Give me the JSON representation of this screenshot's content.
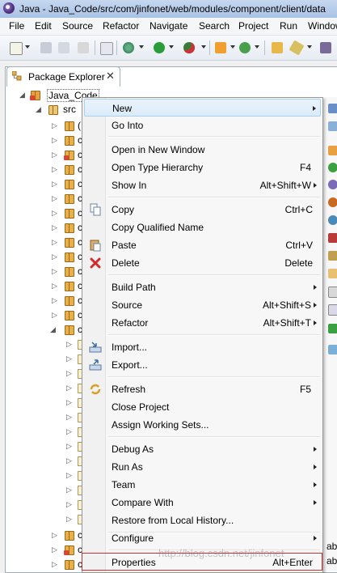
{
  "window": {
    "title": "Java - Java_Code/src/com/jinfonet/web/modules/component/client/data"
  },
  "menubar": [
    "File",
    "Edit",
    "Source",
    "Refactor",
    "Navigate",
    "Search",
    "Project",
    "Run",
    "Window"
  ],
  "view": {
    "tab_label": "Package Explorer",
    "close_glyph": "✕"
  },
  "tree": {
    "project": "Java_Code",
    "src": "src",
    "pkg_label_prefix": "c",
    "first_pkg_label": "("
  },
  "context_menu": {
    "items": [
      {
        "label": "New",
        "shortcut": "",
        "submenu": true,
        "icon": "new-icon"
      },
      {
        "label": "Go Into",
        "shortcut": "",
        "submenu": false
      },
      {
        "label": "Open in New Window",
        "shortcut": "",
        "submenu": false
      },
      {
        "label": "Open Type Hierarchy",
        "shortcut": "F4",
        "submenu": false
      },
      {
        "label": "Show In",
        "shortcut": "Alt+Shift+W",
        "submenu": true
      },
      {
        "label": "Copy",
        "shortcut": "Ctrl+C",
        "submenu": false,
        "icon": "copy-icon"
      },
      {
        "label": "Copy Qualified Name",
        "shortcut": "",
        "submenu": false
      },
      {
        "label": "Paste",
        "shortcut": "Ctrl+V",
        "submenu": false,
        "icon": "paste-icon"
      },
      {
        "label": "Delete",
        "shortcut": "Delete",
        "submenu": false,
        "icon": "delete-icon"
      },
      {
        "label": "Build Path",
        "shortcut": "",
        "submenu": true
      },
      {
        "label": "Source",
        "shortcut": "Alt+Shift+S",
        "submenu": true
      },
      {
        "label": "Refactor",
        "shortcut": "Alt+Shift+T",
        "submenu": true
      },
      {
        "label": "Import...",
        "shortcut": "",
        "submenu": false,
        "icon": "import-icon"
      },
      {
        "label": "Export...",
        "shortcut": "",
        "submenu": false,
        "icon": "export-icon"
      },
      {
        "label": "Refresh",
        "shortcut": "F5",
        "submenu": false,
        "icon": "refresh-icon"
      },
      {
        "label": "Close Project",
        "shortcut": "",
        "submenu": false
      },
      {
        "label": "Assign Working Sets...",
        "shortcut": "",
        "submenu": false
      },
      {
        "label": "Debug As",
        "shortcut": "",
        "submenu": true
      },
      {
        "label": "Run As",
        "shortcut": "",
        "submenu": true
      },
      {
        "label": "Team",
        "shortcut": "",
        "submenu": true
      },
      {
        "label": "Compare With",
        "shortcut": "",
        "submenu": true
      },
      {
        "label": "Restore from Local History...",
        "shortcut": "",
        "submenu": false
      },
      {
        "label": "Configure",
        "shortcut": "",
        "submenu": true
      },
      {
        "label": "Properties",
        "shortcut": "Alt+Enter",
        "submenu": false
      }
    ]
  },
  "right_edge_fragments": [
    "ab",
    "ab"
  ],
  "watermark": "http://blog.csdn.net/jinfonet",
  "colors": {
    "highlight_border": "#d03030",
    "menu_hover": "#dcebfa"
  }
}
